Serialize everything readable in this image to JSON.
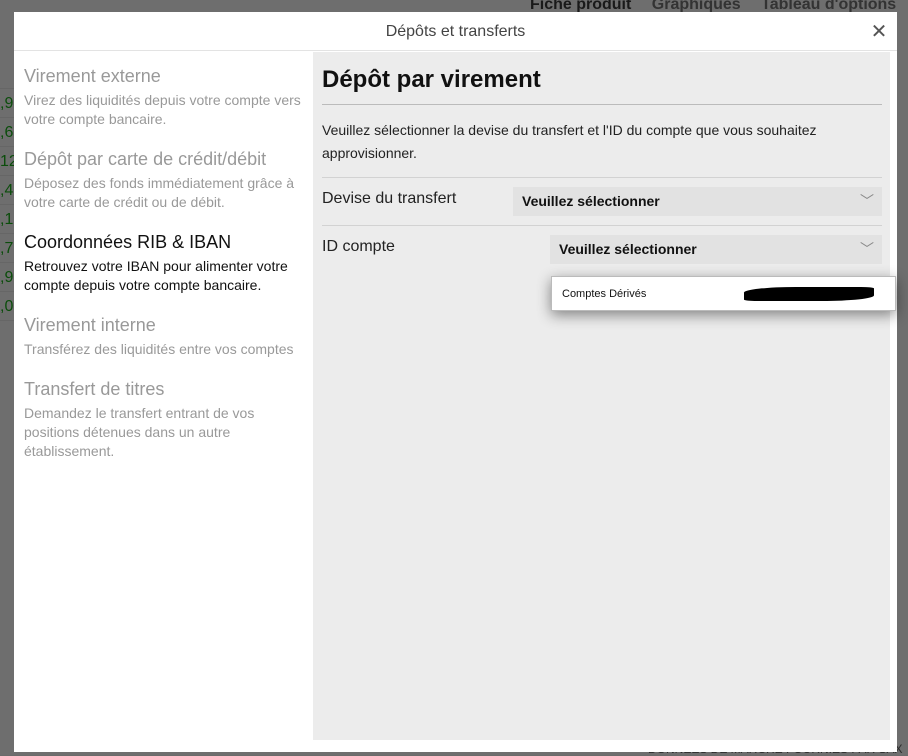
{
  "background": {
    "tabs": [
      "Fiche produit",
      "Graphiques",
      "Tableau d'options"
    ],
    "footer": "DONNÉES DE MARCHÉ FOURNIES PAR SAX"
  },
  "modal": {
    "title": "Dépôts et transferts",
    "close_icon": "close-icon"
  },
  "sidebar": {
    "items": [
      {
        "title": "Virement externe",
        "desc": "Virez des liquidités depuis votre compte vers votre compte bancaire."
      },
      {
        "title": "Dépôt par carte de crédit/débit",
        "desc": "Déposez des fonds immédiatement grâce à votre carte de crédit ou de débit."
      },
      {
        "title": "Coordonnées RIB & IBAN",
        "desc": "Retrouvez votre IBAN pour alimenter votre compte depuis votre compte bancaire.",
        "active": true
      },
      {
        "title": "Virement interne",
        "desc": "Transférez des liquidités entre vos comptes"
      },
      {
        "title": "Transfert de titres",
        "desc": "Demandez le transfert entrant de vos positions détenues dans un autre établissement."
      }
    ]
  },
  "main": {
    "title": "Dépôt par virement",
    "intro": "Veuillez sélectionner la devise du transfert et l'ID du compte que vous souhaitez approvisionner.",
    "currency": {
      "label": "Devise du transfert",
      "value": "Veuillez sélectionner"
    },
    "account": {
      "label": "ID compte",
      "value": "Veuillez sélectionner"
    },
    "dropdown": {
      "options": [
        "Comptes Dérivés"
      ]
    }
  }
}
